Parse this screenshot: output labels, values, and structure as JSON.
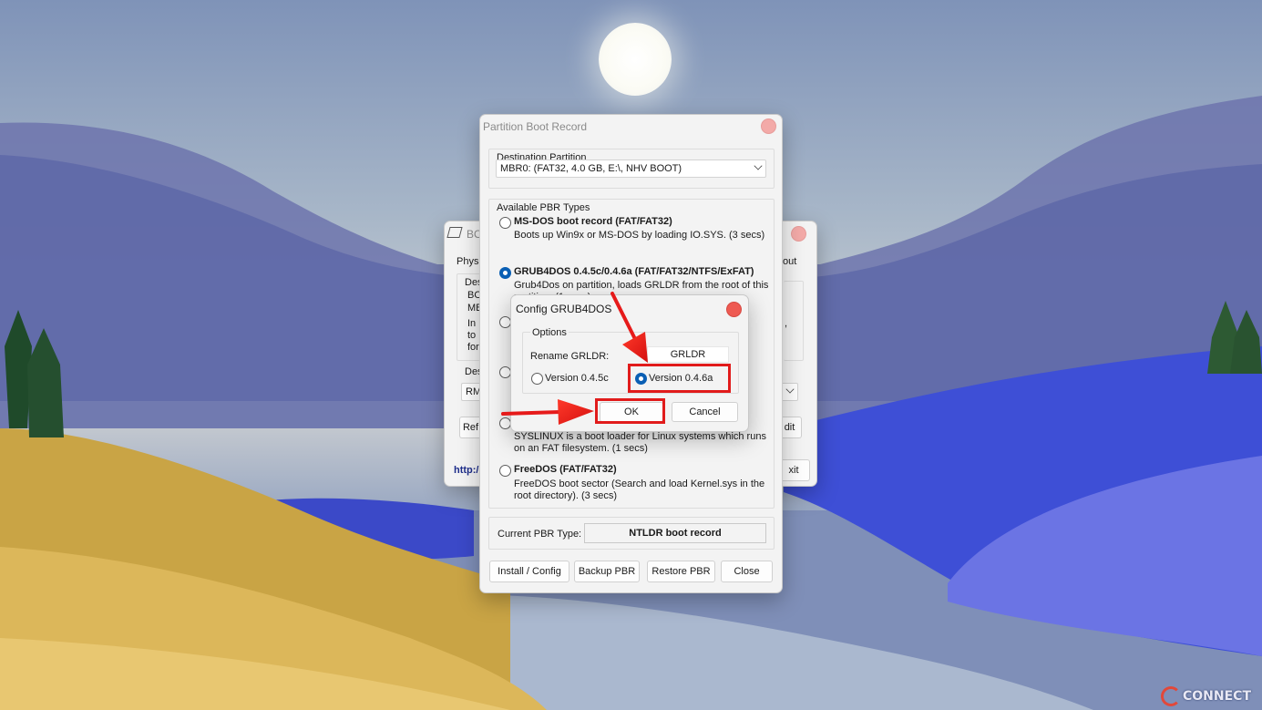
{
  "background_window": {
    "title": "BO",
    "tab_left": "Physi",
    "tab_right": "out",
    "frag_des_1": "Des",
    "frag_bo": "BO",
    "frag_mb": "MB",
    "frag_in": "In",
    "frag_to": "to",
    "frag_for": "for",
    "frag_comma": ",",
    "frag_des_2": "Des",
    "frag_rm": "RM",
    "frag_ref": "Ref",
    "frag_edit": "dit",
    "frag_link": "http:/",
    "frag_exit": "xit"
  },
  "pbr_window": {
    "title": "Partition Boot Record",
    "destination_group_label": "Destination Partition",
    "destination_value": "MBR0: (FAT32,   4.0 GB, E:\\, NHV BOOT)",
    "types_group_label": "Available PBR Types",
    "options": [
      {
        "label": "MS-DOS boot record (FAT/FAT32)",
        "desc": "Boots up Win9x or MS-DOS by loading IO.SYS. (3 secs)",
        "checked": false
      },
      {
        "label": "GRUB4DOS 0.4.5c/0.4.6a (FAT/FAT32/NTFS/ExFAT)",
        "desc": "Grub4Dos on partition, loads GRLDR from the root of this partition. (1 secs)",
        "checked": true
      },
      {
        "label": "",
        "desc": "",
        "checked": false
      },
      {
        "label": "",
        "desc": "",
        "checked": false
      },
      {
        "label": "",
        "desc": "SYSLINUX is a boot loader for Linux systems which runs on an FAT filesystem. (1 secs)",
        "checked": false
      },
      {
        "label": "FreeDOS (FAT/FAT32)",
        "desc": "FreeDOS boot sector (Search and load Kernel.sys in the root directory). (3 secs)",
        "checked": false
      }
    ],
    "current_type_label": "Current PBR Type:",
    "current_type_value": "NTLDR boot record",
    "buttons": {
      "install": "Install / Config",
      "backup": "Backup PBR",
      "restore": "Restore PBR",
      "close": "Close"
    }
  },
  "config_dialog": {
    "title": "Config GRUB4DOS",
    "options_group_label": "Options",
    "rename_label": "Rename GRLDR:",
    "rename_value": "GRLDR",
    "version_045c": "Version 0.4.5c",
    "version_046a": "Version 0.4.6a",
    "selected_version": "Version 0.4.6a",
    "ok": "OK",
    "cancel": "Cancel"
  },
  "watermark": {
    "text": "CONNECT"
  },
  "colors": {
    "highlight": "#e11b1b",
    "radio_checked": "#0a5fb4",
    "close_active": "#ee5a52",
    "close_inactive": "#f3aaa8"
  }
}
